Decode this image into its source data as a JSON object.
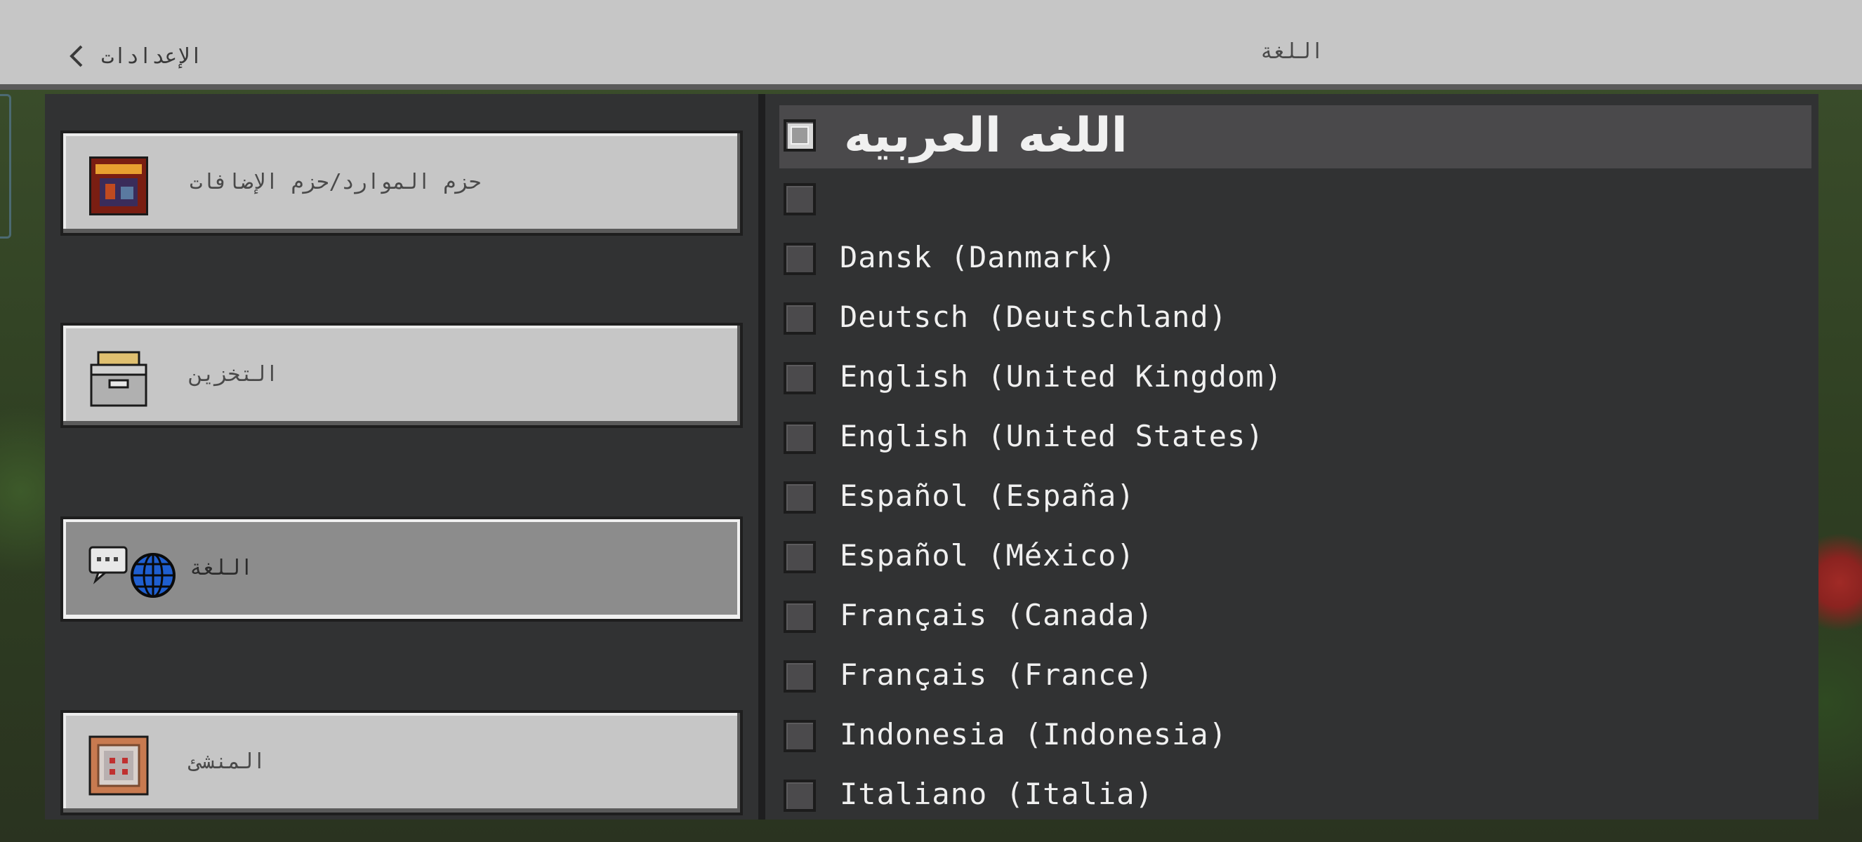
{
  "header": {
    "back_label": "الإعدادات",
    "title": "اللغة"
  },
  "sidebar": {
    "items": [
      {
        "label": "حزم الموارد/حزم الإضافات",
        "icon": "resource-pack-icon",
        "selected": false
      },
      {
        "label": "التخزين",
        "icon": "storage-box-icon",
        "selected": false
      },
      {
        "label": "اللغة",
        "icon": "language-globe-icon",
        "selected": true
      },
      {
        "label": "المنشئ",
        "icon": "command-block-icon",
        "selected": false
      }
    ]
  },
  "languages": {
    "items": [
      {
        "label": "اللغه العربيه",
        "checked": true
      },
      {
        "label": "",
        "checked": false
      },
      {
        "label": "Dansk (Danmark)",
        "checked": false
      },
      {
        "label": "Deutsch (Deutschland)",
        "checked": false
      },
      {
        "label": "English (United Kingdom)",
        "checked": false
      },
      {
        "label": "English (United States)",
        "checked": false
      },
      {
        "label": "Español (España)",
        "checked": false
      },
      {
        "label": "Español (México)",
        "checked": false
      },
      {
        "label": "Français (Canada)",
        "checked": false
      },
      {
        "label": "Français (France)",
        "checked": false
      },
      {
        "label": "Indonesia (Indonesia)",
        "checked": false
      },
      {
        "label": "Italiano (Italia)",
        "checked": false
      }
    ]
  },
  "colors": {
    "panel": "#313233",
    "button": "#c6c6c6",
    "selected_button": "#8c8c8c",
    "text_light": "#f0f0f0"
  }
}
